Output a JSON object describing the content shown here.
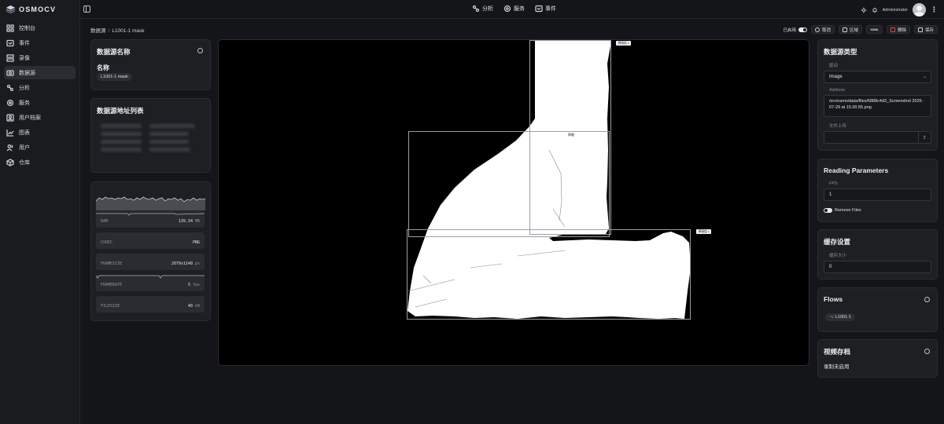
{
  "app": {
    "name": "OSMOCV"
  },
  "sidebar": {
    "items": [
      {
        "label": "控制台",
        "icon": "dashboard-icon"
      },
      {
        "label": "事件",
        "icon": "events-icon"
      },
      {
        "label": "录像",
        "icon": "recordings-icon"
      },
      {
        "label": "数据源",
        "icon": "datasource-icon",
        "active": true
      },
      {
        "label": "分析",
        "icon": "analysis-icon"
      },
      {
        "label": "服务",
        "icon": "services-icon"
      },
      {
        "label": "用户档案",
        "icon": "profiles-icon"
      },
      {
        "label": "图表",
        "icon": "charts-icon"
      },
      {
        "label": "用户",
        "icon": "users-icon"
      },
      {
        "label": "仓库",
        "icon": "warehouse-icon"
      }
    ]
  },
  "topnav": {
    "analysis": "分析",
    "services": "服务",
    "events": "事件"
  },
  "user": {
    "name": "Administrator"
  },
  "breadcrumb": {
    "root": "数据源",
    "separator": "/",
    "current": "L1001-1 mask"
  },
  "actions": {
    "enabled_label": "已启用",
    "cancel": "取消",
    "region": "区域",
    "yaml": "YAML",
    "delete": "删除",
    "save": "保存"
  },
  "source_name_card": {
    "title": "数据源名称",
    "name_label": "名称",
    "name_value": "L1001-1 mask"
  },
  "address_list_card": {
    "title": "数据源地址列表"
  },
  "metrics": {
    "ram": {
      "key": "RAM",
      "value": "139.34",
      "unit": "MB"
    },
    "codec": {
      "key": "CODEC",
      "value": "PNG"
    },
    "framesize": {
      "key": "FRAMESIZE",
      "value": "2079x1148",
      "unit": "px"
    },
    "framerate": {
      "key": "FRAMERATE",
      "value": "5",
      "unit": "fps"
    },
    "filesize": {
      "key": "FILESIZE",
      "value": "40",
      "unit": "kB"
    }
  },
  "viewer": {
    "boxes": [
      {
        "tag": "焊接组 2"
      },
      {
        "tag": "焊缝"
      },
      {
        "tag": "焊接组 1"
      }
    ]
  },
  "source_type_card": {
    "title": "数据源类型",
    "driver_label": "驱动",
    "driver_value": "Image",
    "address_label": "Address",
    "address_value": "/srv/osmo/data/files/6888c4d3_Screenshot 2025-07-29 at 15.00.55.png",
    "upload_label": "文件上传"
  },
  "reading_params_card": {
    "title": "Reading Parameters",
    "fps_label": "FPS",
    "fps_value": "1",
    "remove_files_label": "Remove Files"
  },
  "cache_card": {
    "title": "缓存设置",
    "size_label": "缓存大小",
    "size_value": "0"
  },
  "flows_card": {
    "title": "Flows",
    "flow_item": "L1001-1"
  },
  "video_archive_card": {
    "title": "视频存档",
    "status": "录制未启用"
  }
}
